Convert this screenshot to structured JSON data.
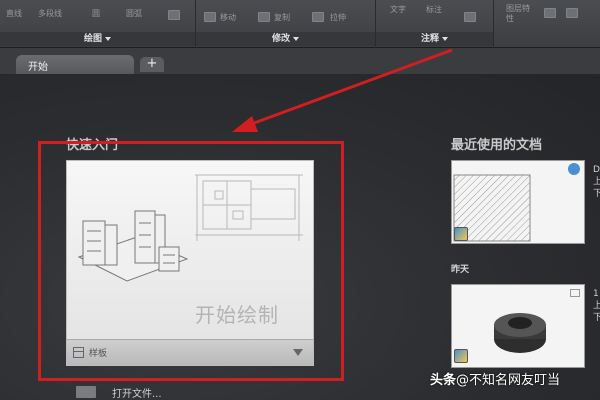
{
  "ribbon": {
    "panels": [
      {
        "label": "绘图",
        "tools": [
          "直线",
          "多段线",
          "圆",
          "圆弧"
        ]
      },
      {
        "label": "修改",
        "tools": [
          "移动",
          "复制",
          "拉伸"
        ]
      },
      {
        "label": "注释",
        "tools": [
          "文字",
          "标注",
          "表格"
        ]
      },
      {
        "label": "",
        "tools": [
          "图层特性"
        ]
      }
    ]
  },
  "tabs": {
    "active": "开始",
    "add": "+"
  },
  "quick_start": {
    "title": "快速入门",
    "card_label": "开始绘制",
    "template_label": "样板",
    "open_file": "打开文件..."
  },
  "recent": {
    "title": "最近使用的文档",
    "day_label": "昨天",
    "doc_side_top": [
      "D",
      "上",
      "下"
    ],
    "doc_side_bottom": [
      "1",
      "上",
      "下"
    ]
  },
  "annotation": {
    "arrow_color": "#d21e1e",
    "box_color": "#d21e1e"
  },
  "watermark": {
    "prefix": "头条",
    "text": "@不知名网友叮当"
  }
}
